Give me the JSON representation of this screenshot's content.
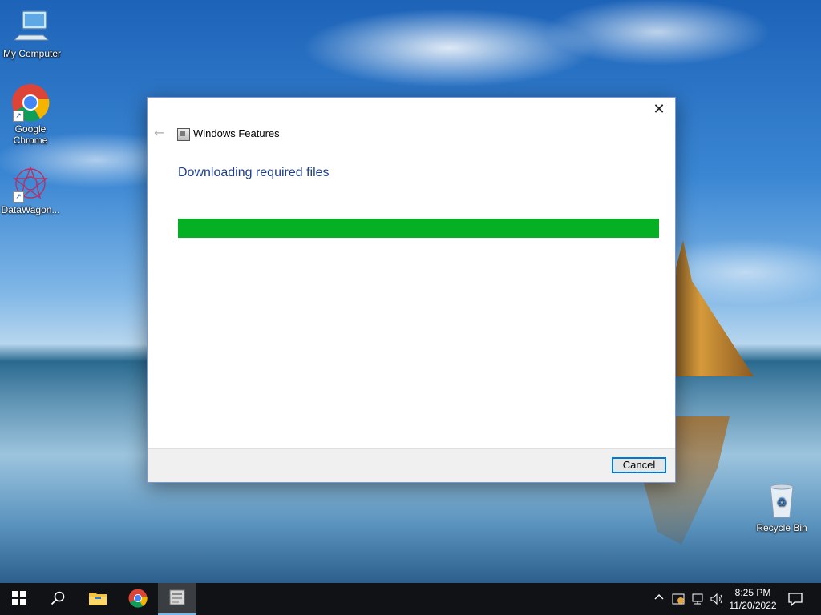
{
  "desktop": {
    "icons": [
      {
        "label": "My Computer"
      },
      {
        "label": "Google\nChrome"
      },
      {
        "label": "DataWagon..."
      },
      {
        "label": "Recycle Bin"
      }
    ]
  },
  "dialog": {
    "title": "Windows Features",
    "heading": "Downloading required files",
    "progress": 1.0,
    "progress_color": "#06b025",
    "cancel_label": "Cancel",
    "close_glyph": "✕",
    "back_glyph": "←"
  },
  "taskbar": {
    "time": "8:25 PM",
    "date": "11/20/2022",
    "pinned": [
      "start-icon",
      "search-icon",
      "file-explorer-icon",
      "chrome-icon",
      "windows-features-icon"
    ],
    "tray": [
      "chevron-up-icon",
      "security-icon",
      "network-icon",
      "volume-icon",
      "notification-icon"
    ]
  },
  "colors": {
    "accent": "#0078d7",
    "heading": "#1e3f8f",
    "taskbar": "#101216"
  }
}
